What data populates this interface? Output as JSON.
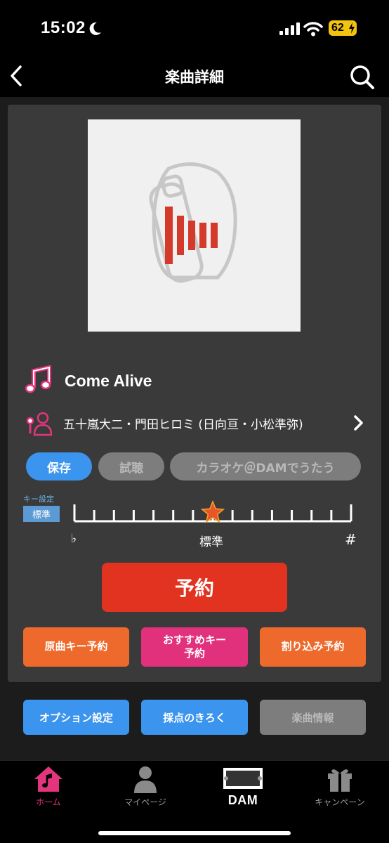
{
  "status_bar": {
    "time": "15:02",
    "battery": "62"
  },
  "nav": {
    "title": "楽曲詳細"
  },
  "song": {
    "title": "Come Alive",
    "artist": "五十嵐大二・門田ヒロミ (日向亘・小松準弥)"
  },
  "actions": {
    "save": "保存",
    "listen": "試聴",
    "karaoke": "カラオケ＠DAMでうたう"
  },
  "key": {
    "setting_label": "キー設定",
    "current": "標準",
    "flat": "♭",
    "standard": "標準",
    "sharp": "#",
    "steps": 15,
    "selected_index": 7
  },
  "reserve": {
    "label": "予約"
  },
  "reserve_options": {
    "original_key": "原曲キー予約",
    "recommended_key_line1": "おすすめキー",
    "recommended_key_line2": "予約",
    "interrupt": "割り込み予約"
  },
  "options": {
    "option_settings": "オプション設定",
    "score_record": "採点のきろく",
    "song_info": "楽曲情報"
  },
  "tab_bar": {
    "home": "ホーム",
    "mypage": "マイページ",
    "dam": "DAM",
    "campaign": "キャンペーン"
  },
  "colors": {
    "accent_blue": "#3b94ee",
    "reserve_red": "#e23320",
    "orange": "#ee6a2c",
    "pink": "#e1317c",
    "disabled": "#7d7d7d"
  }
}
